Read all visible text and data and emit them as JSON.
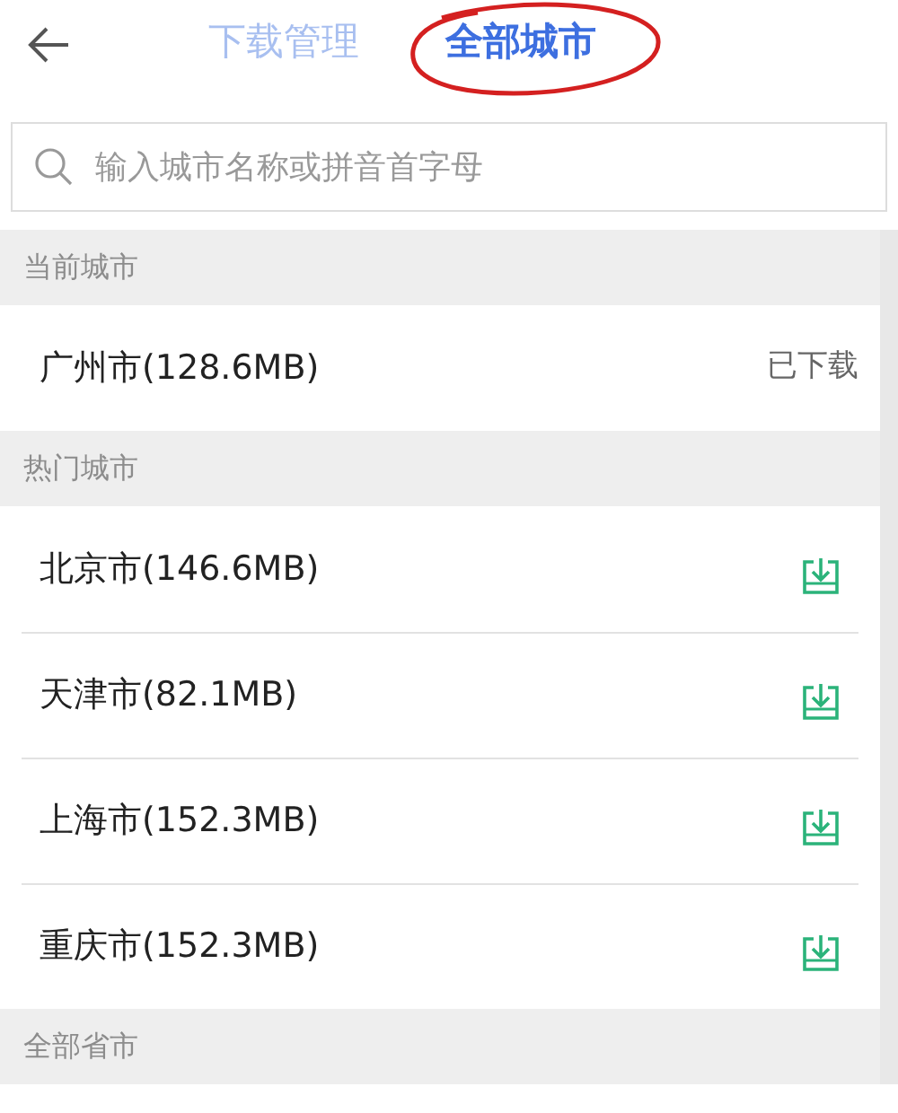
{
  "header": {
    "tabs": [
      {
        "label": "下载管理",
        "selected": false,
        "circled": false
      },
      {
        "label": "全部城市",
        "selected": true,
        "circled": true
      }
    ]
  },
  "search": {
    "placeholder": "输入城市名称或拼音首字母"
  },
  "sections": [
    {
      "title": "当前城市",
      "rows": [
        {
          "name": "广州市(128.6MB)",
          "kind": "downloaded",
          "status": "已下载"
        }
      ]
    },
    {
      "title": "热门城市",
      "rows": [
        {
          "name": "北京市(146.6MB)",
          "kind": "download"
        },
        {
          "name": "天津市(82.1MB)",
          "kind": "download"
        },
        {
          "name": "上海市(152.3MB)",
          "kind": "download"
        },
        {
          "name": "重庆市(152.3MB)",
          "kind": "download"
        }
      ]
    },
    {
      "title": "全部省市"
    }
  ]
}
